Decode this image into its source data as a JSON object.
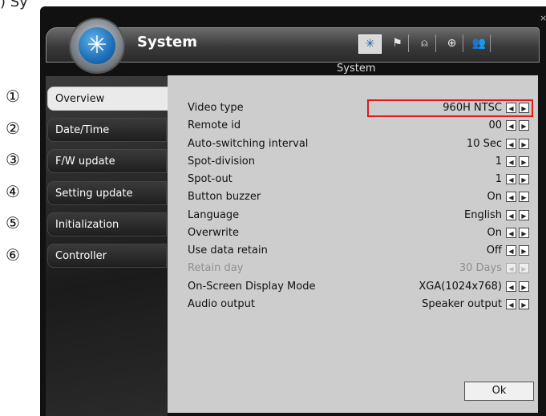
{
  "caption_fragment": ") Sy",
  "window": {
    "close_glyph": "×"
  },
  "header": {
    "title": "System",
    "subtitle": "System",
    "icons": [
      {
        "name": "system-icon",
        "glyph": "✳",
        "active": true
      },
      {
        "name": "flag-icon",
        "glyph": "⚑",
        "active": false
      },
      {
        "name": "bell-icon",
        "glyph": "⍝",
        "active": false
      },
      {
        "name": "globe-icon",
        "glyph": "⊕",
        "active": false
      },
      {
        "name": "users-icon",
        "glyph": "👥",
        "active": false
      }
    ]
  },
  "sidebar": {
    "items": [
      {
        "label": "Overview",
        "active": true
      },
      {
        "label": "Date/Time",
        "active": false
      },
      {
        "label": "F/W update",
        "active": false
      },
      {
        "label": "Setting update",
        "active": false
      },
      {
        "label": "Initialization",
        "active": false
      },
      {
        "label": "Controller",
        "active": false
      }
    ],
    "markers": [
      "①",
      "②",
      "③",
      "④",
      "⑤",
      "⑥"
    ]
  },
  "settings": [
    {
      "label": "Video type",
      "value": "960H NTSC",
      "enabled": true,
      "highlighted": true
    },
    {
      "label": "Remote id",
      "value": "00",
      "enabled": true
    },
    {
      "label": "Auto-switching interval",
      "value": "10 Sec",
      "enabled": true
    },
    {
      "label": "Spot-division",
      "value": "1",
      "enabled": true
    },
    {
      "label": "Spot-out",
      "value": "1",
      "enabled": true
    },
    {
      "label": "Button buzzer",
      "value": "On",
      "enabled": true
    },
    {
      "label": "Language",
      "value": "English",
      "enabled": true
    },
    {
      "label": "Overwrite",
      "value": "On",
      "enabled": true
    },
    {
      "label": "Use data retain",
      "value": "Off",
      "enabled": true
    },
    {
      "label": "Retain day",
      "value": "30 Days",
      "enabled": false
    },
    {
      "label": "On-Screen Display Mode",
      "value": "XGA(1024x768)",
      "enabled": true
    },
    {
      "label": "Audio output",
      "value": "Speaker output",
      "enabled": true
    }
  ],
  "arrows": {
    "left": "◀",
    "right": "▶"
  },
  "buttons": {
    "ok_label": "Ok"
  },
  "colors": {
    "highlight_border": "#e01b1b",
    "panel_bg": "#cdcdcd",
    "frame_bg": "#111111"
  }
}
